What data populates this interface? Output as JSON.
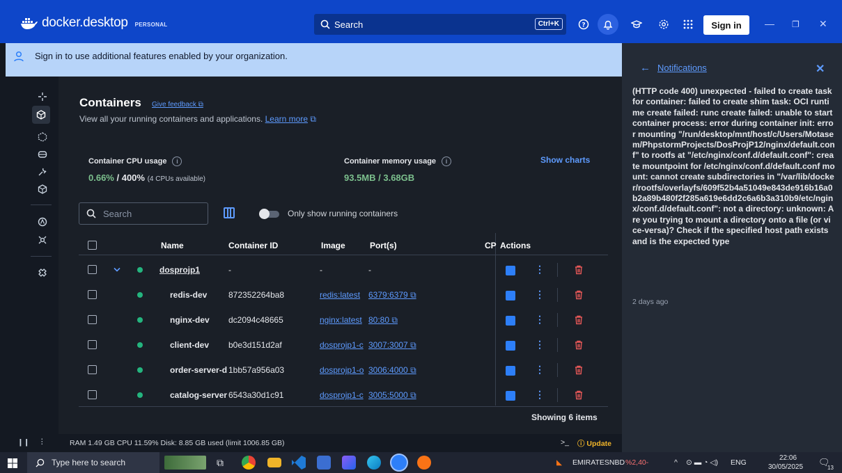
{
  "titlebar": {
    "brand": "docker.desktop",
    "plan": "PERSONAL",
    "search_label": "Search",
    "search_shortcut": "Ctrl+K",
    "signin_label": "Sign in"
  },
  "banner": {
    "text": "Sign in to use additional features enabled by your organization."
  },
  "containers": {
    "title": "Containers",
    "feedback": "Give feedback",
    "subtitle": "View all your running containers and applications.",
    "learn_more": "Learn more",
    "cpu_label": "Container CPU usage",
    "cpu_used": "0.66%",
    "cpu_sep": " / ",
    "cpu_total": "400%",
    "cpu_note": "(4 CPUs available)",
    "mem_label": "Container memory usage",
    "mem_value": "93.5MB / 3.68GB",
    "show_charts": "Show charts",
    "search_placeholder": "Search",
    "running_only": "Only show running containers",
    "columns": [
      "Name",
      "Container ID",
      "Image",
      "Port(s)",
      "CP",
      "Actions"
    ],
    "rows": [
      {
        "name": "dosprojp1",
        "id": "-",
        "image": "-",
        "ports": "-",
        "group": true
      },
      {
        "name": "redis-dev",
        "id": "872352264ba8",
        "image": "redis:latest",
        "ports": "6379:6379"
      },
      {
        "name": "nginx-dev",
        "id": "dc2094c48665",
        "image": "nginx:latest",
        "ports": "80:80"
      },
      {
        "name": "client-dev",
        "id": "b0e3d151d2af",
        "image": "dosprojp1-c",
        "ports": "3007:3007"
      },
      {
        "name": "order-server-dev",
        "id": "1bb57a956a03",
        "image": "dosprojp1-o",
        "ports": "3006:4000"
      },
      {
        "name": "catalog-server-dev",
        "id": "6543a30d1c91",
        "image": "dosprojp1-c",
        "ports": "3005:5000"
      }
    ],
    "showing": "Showing 6 items"
  },
  "notifications": {
    "title": "Notifications",
    "message": "(HTTP code 400) unexpected - failed to create task for container: failed to create shim task: OCI runtime create failed: runc create failed: unable to start container process: error during container init: error mounting \"/run/desktop/mnt/host/c/Users/Motasem/PhpstormProjects/DosProjP12/nginx/default.conf\" to rootfs at \"/etc/nginx/conf.d/default.conf\": create mountpoint for /etc/nginx/conf.d/default.conf mount: cannot create subdirectories in \"/var/lib/docker/rootfs/overlayfs/609f52b4a51049e843de916b16a0b2a89b480f2f285a619e6dd2c6a6b3a310b9/etc/nginx/conf.d/default.conf\": not a directory: unknown: Are you trying to mount a directory onto a file (or vice-versa)? Check if the specified host path exists and is the expected type",
    "time": "2 days ago"
  },
  "statusbar": {
    "stats": "RAM 1.49 GB  CPU 11.59%  Disk: 8.85 GB used (limit 1006.85 GB)",
    "update": "Update"
  },
  "taskbar": {
    "search_placeholder": "Type here to search",
    "stock": "EMIRATESNBD",
    "stock_change": "%2,40-",
    "lang": "ENG",
    "time": "22:06",
    "date": "30/05/2025",
    "notif_count": "13"
  },
  "colors": {
    "titlebar": "#0e46c9",
    "accent": "#5e9bff",
    "running": "#24b47e",
    "delete": "#e45757",
    "cpu_value": "#7cc08d"
  }
}
